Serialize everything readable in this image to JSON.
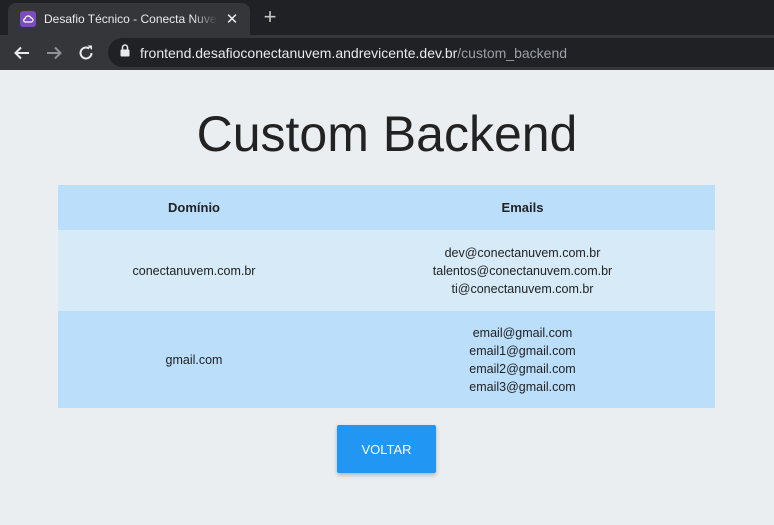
{
  "browser": {
    "tab": {
      "title": "Desafio Técnico - Conecta Nuvem",
      "close_glyph": "✕"
    },
    "new_tab_glyph": "+",
    "address": {
      "host": "frontend.desafioconectanuvem.andrevicente.dev.br",
      "path": "/custom_backend"
    }
  },
  "page": {
    "title": "Custom Backend",
    "table": {
      "headers": [
        "Domínio",
        "Emails"
      ],
      "rows": [
        {
          "domain": "conectanuvem.com.br",
          "emails": [
            "dev@conectanuvem.com.br",
            "talentos@conectanuvem.com.br",
            "ti@conectanuvem.com.br"
          ]
        },
        {
          "domain": "gmail.com",
          "emails": [
            "email@gmail.com",
            "email1@gmail.com",
            "email2@gmail.com",
            "email3@gmail.com"
          ]
        }
      ]
    },
    "back_button_label": "VOLTAR"
  },
  "colors": {
    "accent": "#2196f3",
    "header_row": "#bbdefb",
    "row_light": "#d6eaf8",
    "page_background": "#ebeef1"
  }
}
